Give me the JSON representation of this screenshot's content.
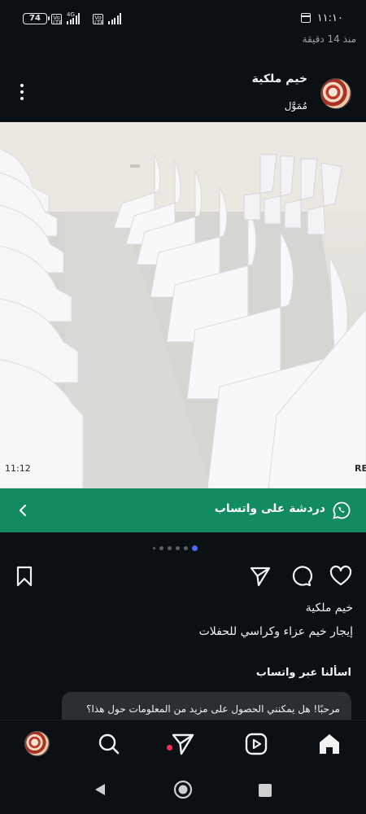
{
  "status_bar": {
    "battery": "74",
    "network_tag_1": "Vo LTE",
    "network_type": "4G",
    "network_tag_2": "Vo LTE",
    "time": "١١:١٠",
    "posted_ago": "منذ 14 دقيقة"
  },
  "post": {
    "account_name": "خيم ملكية",
    "sponsored_label": "مُمَوَّل",
    "photo_timestamp": "11:12",
    "photo_edge_text": "RE",
    "whatsapp_cta": "دردشة على واتساب",
    "carousel_count": 6,
    "carousel_active_index": 5,
    "caption_account": "خيم ملكية",
    "caption_text": "إيجار خيم عزاء وكراسي للحفلات",
    "ask_label": "اسألنا عبر واتساب",
    "message_bubble": "مرحبًا! هل يمكنني الحصول على مزيد من المعلومات حول هذا؟"
  },
  "icons": {
    "more": "more-vertical-icon",
    "whatsapp": "whatsapp-icon",
    "back": "chevron-left-icon",
    "save": "bookmark-icon",
    "share": "send-icon",
    "comment": "comment-icon",
    "like": "heart-icon",
    "home": "home-icon",
    "reels": "reels-icon",
    "send_nav": "send-icon",
    "search": "search-icon",
    "profile": "profile-avatar"
  },
  "colors": {
    "background": "#0b1014",
    "whatsapp_banner": "#128b5e",
    "active_dot": "#4a6cf7",
    "notification_dot": "#ff2d55"
  }
}
